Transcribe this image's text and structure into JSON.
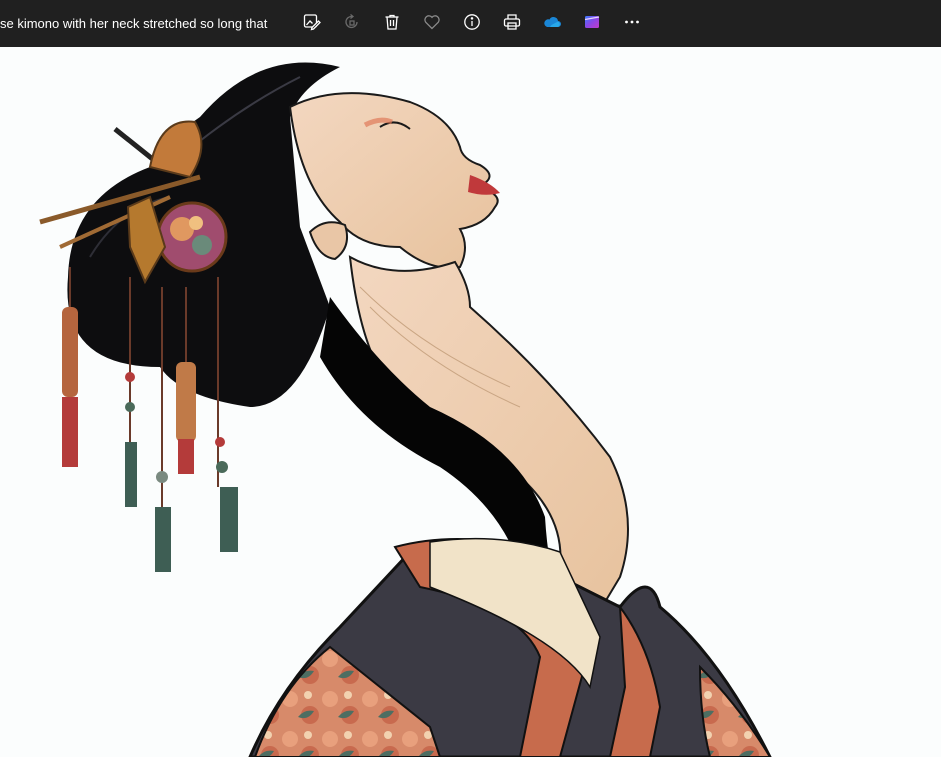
{
  "window": {
    "file_title": "se kimono with her neck stretched so long that i..."
  },
  "toolbar": {
    "items": [
      {
        "name": "edit-image-button",
        "icon": "edit-image-icon"
      },
      {
        "name": "rotate-button",
        "icon": "rotate-icon",
        "disabled": true
      },
      {
        "name": "delete-button",
        "icon": "trash-icon"
      },
      {
        "name": "favorite-button",
        "icon": "heart-icon"
      },
      {
        "name": "info-button",
        "icon": "info-icon"
      },
      {
        "name": "print-button",
        "icon": "printer-icon"
      },
      {
        "name": "onedrive-button",
        "icon": "onedrive-cloud-icon"
      },
      {
        "name": "clipchamp-button",
        "icon": "clipchamp-icon"
      },
      {
        "name": "more-options-button",
        "icon": "ellipsis-icon"
      }
    ]
  },
  "colors": {
    "toolbar_bg": "#202020",
    "canvas_bg": "#fbfdfd",
    "onedrive_blue": "#1a86d6",
    "clipchamp_purple": "#7a4fd6"
  }
}
